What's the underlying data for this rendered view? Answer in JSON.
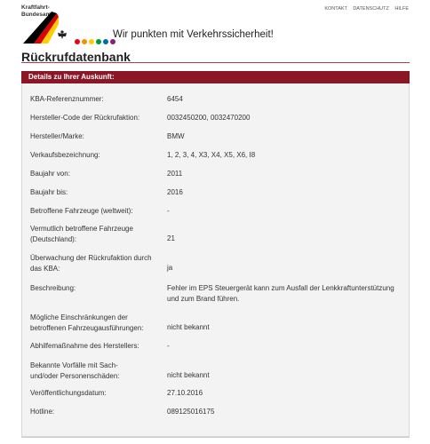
{
  "header": {
    "authority_line1": "Kraftfahrt-",
    "authority_line2": "Bundesamt",
    "slogan": "Wir punkten mit Verkehrssicherheit!",
    "links": [
      "KONTAKT",
      "DATENSCHUTZ",
      "HILFE"
    ],
    "dot_colors": [
      "#e30613",
      "#f39200",
      "#ffcc00",
      "#009640",
      "#0069b4",
      "#8b1a8b"
    ]
  },
  "page_title": "Rückrufdatenbank",
  "panel": {
    "header": "Details zu Ihrer Auskunft:",
    "rows": [
      {
        "label": "KBA-Referenznummer:",
        "value": "6454"
      },
      {
        "label": "Hersteller-Code der Rückrufaktion:",
        "value": "0032450200, 0032470200"
      },
      {
        "label": "Hersteller/Marke:",
        "value": "BMW"
      },
      {
        "label": "Verkaufsbezeichnung:",
        "value": "1, 2, 3, 4, X3, X4, X5, X6, I8"
      },
      {
        "label": "Baujahr von:",
        "value": "2011"
      },
      {
        "label": "Baujahr bis:",
        "value": "2016"
      },
      {
        "label": "Betroffene Fahrzeuge (weltweit):",
        "value": "-"
      },
      {
        "label": "Vermutlich betroffene Fahrzeuge (Deutschland):",
        "value": "21"
      },
      {
        "label": "Überwachung der Rückrufaktion durch das KBA:",
        "value": "ja"
      },
      {
        "label": "Beschreibung:",
        "value": "Fehler im EPS Steuergerät kann zum Ausfall der Lenkkraftunterstützung und zum Brand führen."
      },
      {
        "label": "Mögliche Einschränkungen der betroffenen Fahrzeugausführungen:",
        "value": "nicht bekannt"
      },
      {
        "label": "Abhilfemaßnahme des Herstellers:",
        "value": "-"
      },
      {
        "label": "Bekannte Vorfälle mit Sach- und/oder Personenschäden:",
        "value": "nicht bekannt"
      },
      {
        "label": "Veröffentlichungsdatum:",
        "value": "27.10.2016"
      },
      {
        "label": "Hotline:",
        "value": "089125016175"
      }
    ]
  }
}
